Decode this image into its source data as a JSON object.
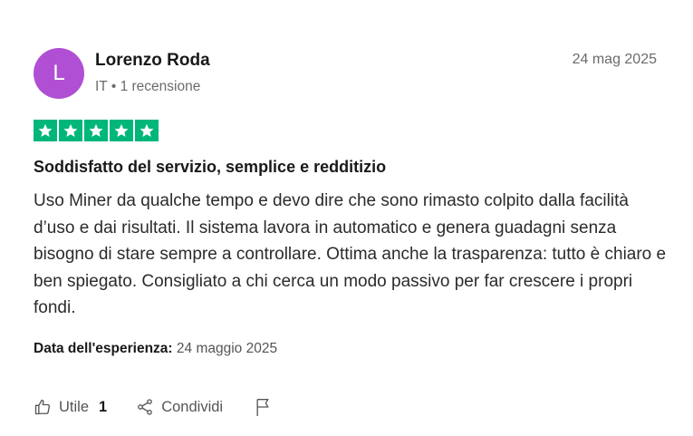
{
  "reviewer": {
    "avatar_initial": "L",
    "avatar_color": "#b04fd3",
    "name": "Lorenzo Roda",
    "country": "IT",
    "separator": "•",
    "reviews_count": "1 recensione"
  },
  "review": {
    "date": "24 mag 2025",
    "rating": 5,
    "star_color": "#00b67a",
    "title": "Soddisfatto del servizio, semplice e redditizio",
    "body": "Uso Miner da qualche tempo e devo dire che sono rimasto colpito dalla facilità d’uso e dai risultati. Il sistema lavora in automatico e genera guadagni senza bisogno di stare sempre a controllare. Ottima anche la trasparenza: tutto è chiaro e ben spiegato. Consigliato a chi cerca un modo passivo per far crescere i propri fondi.",
    "experience_label": "Data dell'esperienza:",
    "experience_date": "24 maggio 2025"
  },
  "actions": {
    "useful_label": "Utile",
    "useful_count": "1",
    "share_label": "Condividi",
    "icons": [
      "thumbs-up-icon",
      "share-icon",
      "flag-icon"
    ]
  }
}
